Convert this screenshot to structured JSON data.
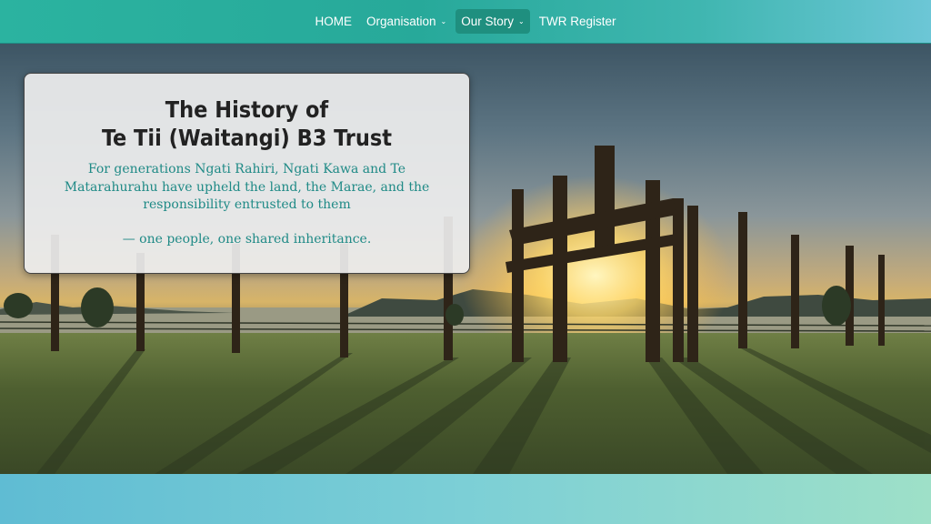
{
  "nav": {
    "items": [
      {
        "label": "HOME",
        "has_dropdown": false,
        "active": false
      },
      {
        "label": "Organisation",
        "has_dropdown": true,
        "active": false
      },
      {
        "label": "Our Story",
        "has_dropdown": true,
        "active": true
      },
      {
        "label": "TWR Register",
        "has_dropdown": false,
        "active": false
      }
    ],
    "dropdown_icon": "chevron-down-icon"
  },
  "hero": {
    "title_line1": "The History of",
    "title_line2": "Te Tii (Waitangi) B3 Trust",
    "body": "For generations Ngati Rahiri, Ngati Kawa and Te Matarahurahu have upheld the land, the Marae, and the responsibility entrusted to them",
    "tagline": "— one people, one shared inheritance."
  },
  "colors": {
    "nav_bg": "#27a99a",
    "nav_active": "#1f8f7f",
    "accent_text": "#1f8a86",
    "footer_gradient_start": "#5fbcd3",
    "footer_gradient_end": "#9ee0c8"
  }
}
